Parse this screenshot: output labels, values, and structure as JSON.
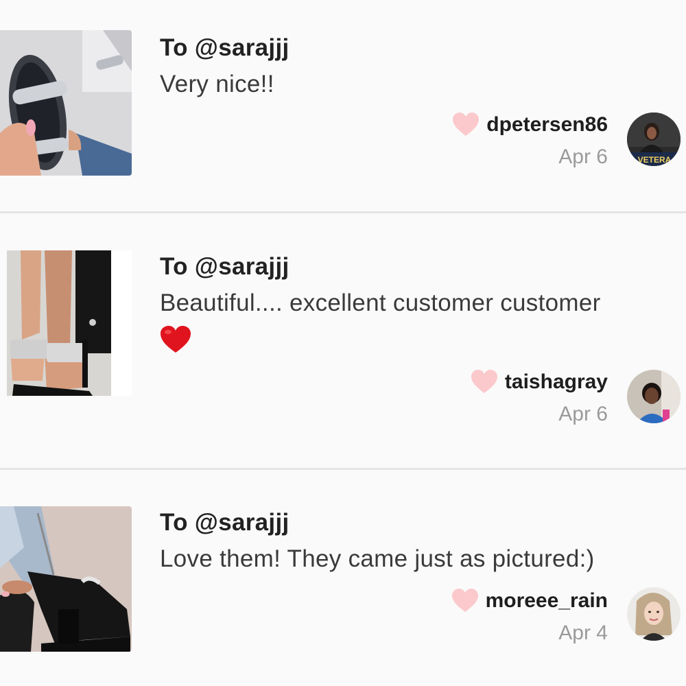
{
  "reviews": [
    {
      "to": "To @sarajjj",
      "message": "Very nice!!",
      "username": "dpetersen86",
      "date": "Apr 6",
      "avatar_label": "VETERA"
    },
    {
      "to": "To @sarajjj",
      "message": "Beautiful.... excellent customer customer",
      "username": "taishagray",
      "date": "Apr 6"
    },
    {
      "to": "To @sarajjj",
      "message": "Love them! They came just as pictured:)",
      "username": "moreee_rain",
      "date": "Apr 4"
    }
  ],
  "icons": {
    "like": "heart-icon",
    "emoji": "red-heart-emoji"
  },
  "colors": {
    "like_heart": "#fbc9cc",
    "emoji_heart": "#e0141e",
    "divider": "#e4e4e4"
  }
}
